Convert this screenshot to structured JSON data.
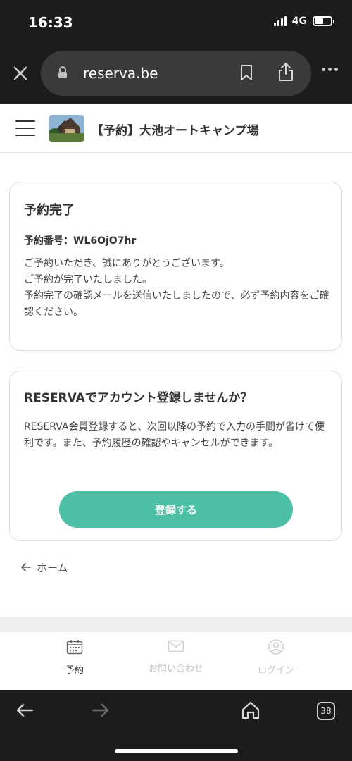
{
  "status_bar": {
    "time": "16:33",
    "network": "4G"
  },
  "browser": {
    "url": "reserva.be",
    "tab_count": "38"
  },
  "site": {
    "title": "【予約】大池オートキャンプ場"
  },
  "confirmation": {
    "title": "予約完了",
    "reservation_number": "予約番号：WL6OjO7hr",
    "body": "ご予約いただき、誠にありがとうございます。\nご予約が完了いたしました。\n予約完了の確認メールを送信いたしましたので、必ず予約内容をご確認ください。"
  },
  "signup": {
    "title": "RESERVAでアカウント登録しませんか？",
    "body": "RESERVA会員登録すると、次回以降の予約で入力の手間が省けて便利です。また、予約履歴の確認やキャンセルができます。",
    "button_label": "登録する"
  },
  "home_link": "ホーム",
  "tab_bar": {
    "items": [
      {
        "label": "予約",
        "icon": "calendar-icon",
        "active": true
      },
      {
        "label": "お問い合わせ",
        "icon": "mail-icon",
        "active": false
      },
      {
        "label": "ログイン",
        "icon": "user-icon",
        "active": false
      }
    ]
  },
  "colors": {
    "accent": "#4cbfa4",
    "chrome": "#1c1c1e",
    "url_pill": "#3a3a3c"
  }
}
